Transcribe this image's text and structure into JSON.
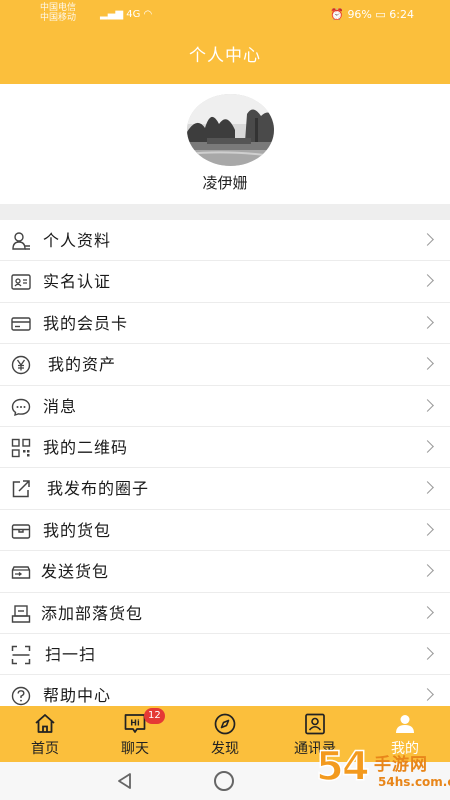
{
  "status_bar": {
    "carrier_line1": "中国电信",
    "carrier_line2": "中国移动",
    "network": "4G",
    "battery": "96%",
    "time": "6:24"
  },
  "header": {
    "title": "个人中心"
  },
  "profile": {
    "username": "凌伊姗",
    "avatar_icon": "avatar-photo"
  },
  "menu": [
    {
      "label": "个人资料",
      "icon": "person-icon"
    },
    {
      "label": "实名认证",
      "icon": "id-card-icon"
    },
    {
      "label": "我的会员卡",
      "icon": "card-icon"
    },
    {
      "label": "我的资产",
      "icon": "yen-icon"
    },
    {
      "label": "消息",
      "icon": "message-icon"
    },
    {
      "label": "我的二维码",
      "icon": "qrcode-icon"
    },
    {
      "label": "我发布的圈子",
      "icon": "share-icon"
    },
    {
      "label": "我的货包",
      "icon": "package-icon"
    },
    {
      "label": "发送货包",
      "icon": "send-package-icon"
    },
    {
      "label": "添加部落货包",
      "icon": "add-package-icon"
    },
    {
      "label": "扫一扫",
      "icon": "scan-icon"
    },
    {
      "label": "帮助中心",
      "icon": "help-icon"
    }
  ],
  "tabs": [
    {
      "label": "首页",
      "icon": "home-icon"
    },
    {
      "label": "聊天",
      "icon": "chat-icon",
      "badge": "12"
    },
    {
      "label": "发现",
      "icon": "compass-icon"
    },
    {
      "label": "通讯录",
      "icon": "contacts-icon"
    },
    {
      "label": "我的",
      "icon": "me-icon",
      "active": true
    }
  ],
  "watermark": {
    "number": "54",
    "text": "手游网",
    "url": "54hs.com.cn"
  },
  "colors": {
    "accent": "#fbbf3c",
    "badge": "#e53935"
  }
}
